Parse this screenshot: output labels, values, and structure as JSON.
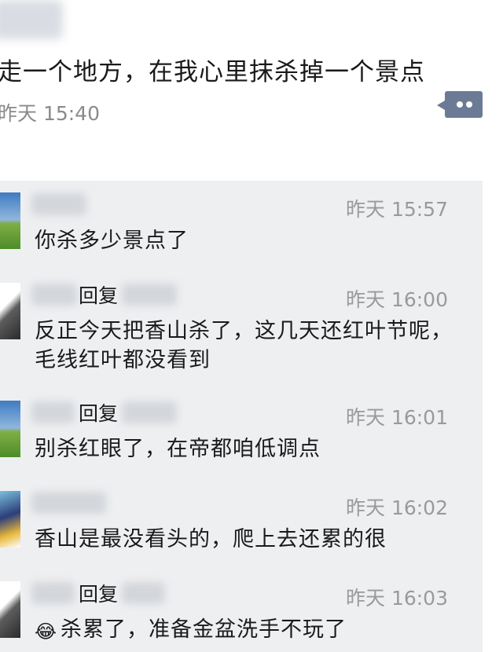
{
  "post": {
    "text": "走一个地方，在我心里抹杀掉一个景点",
    "time": "昨天 15:40"
  },
  "comments": [
    {
      "reply_word": "",
      "time": "昨天 15:57",
      "text": "你杀多少景点了"
    },
    {
      "reply_word": "回复",
      "time": "昨天 16:00",
      "text": "反正今天把香山杀了，这几天还红叶节呢，毛线红叶都没看到"
    },
    {
      "reply_word": "回复",
      "time": "昨天 16:01",
      "text": "别杀红眼了，在帝都咱低调点"
    },
    {
      "reply_word": "",
      "time": "昨天 16:02",
      "text": "香山是最没看头的，爬上去还累的很"
    },
    {
      "reply_word": "回复",
      "time": "昨天 16:03",
      "emoji": "😂",
      "text": "杀累了，准备金盆洗手不玩了"
    }
  ],
  "icons": [
    "comment-more-icon",
    "avatar-landscape",
    "avatar-portrait",
    "avatar-cartoon",
    "tears-of-joy-emoji"
  ]
}
